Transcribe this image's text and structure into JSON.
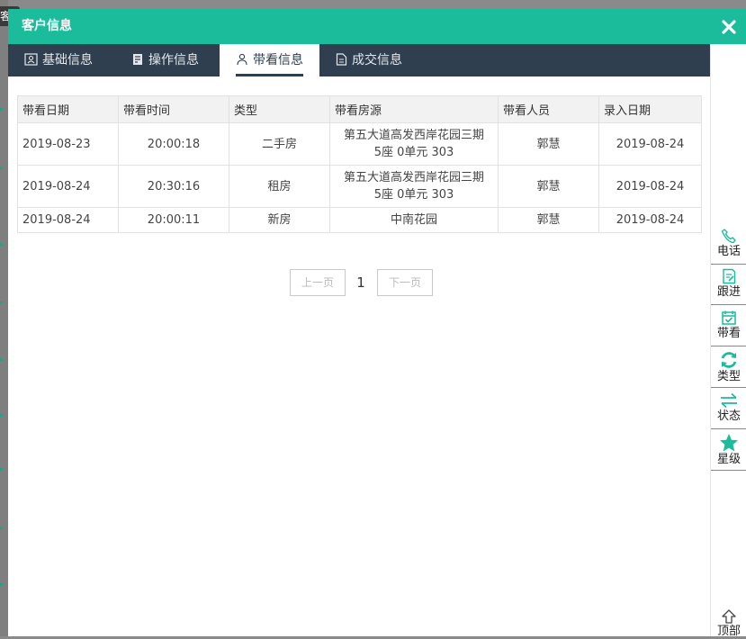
{
  "bg": {
    "tag": "客"
  },
  "modal": {
    "title": "客户信息"
  },
  "tabs": [
    {
      "label": "基础信息",
      "icon": "id-card-icon"
    },
    {
      "label": "操作信息",
      "icon": "edit-note-icon"
    },
    {
      "label": "带看信息",
      "icon": "people-icon",
      "active": true
    },
    {
      "label": "成交信息",
      "icon": "document-icon"
    }
  ],
  "table": {
    "headers": [
      "带看日期",
      "带看时间",
      "类型",
      "带看房源",
      "带看人员",
      "录入日期"
    ],
    "rows": [
      {
        "date": "2019-08-23",
        "time": "20:00:18",
        "type": "二手房",
        "house_line1": "第五大道高发西岸花园三期",
        "house_line2": "5座 0单元 303",
        "staff": "郭慧",
        "entry": "2019-08-24"
      },
      {
        "date": "2019-08-24",
        "time": "20:30:16",
        "type": "租房",
        "house_line1": "第五大道高发西岸花园三期",
        "house_line2": "5座 0单元 303",
        "staff": "郭慧",
        "entry": "2019-08-24"
      },
      {
        "date": "2019-08-24",
        "time": "20:00:11",
        "type": "新房",
        "house_line1": "中南花园",
        "house_line2": "",
        "staff": "郭慧",
        "entry": "2019-08-24"
      }
    ]
  },
  "pager": {
    "prev": "上一页",
    "page": "1",
    "next": "下一页"
  },
  "sidebar": {
    "items": [
      {
        "label": "电话",
        "icon": "phone-icon"
      },
      {
        "label": "跟进",
        "icon": "follow-up-icon"
      },
      {
        "label": "带看",
        "icon": "calendar-check-icon"
      },
      {
        "label": "类型",
        "icon": "refresh-icon"
      },
      {
        "label": "状态",
        "icon": "swap-icon"
      },
      {
        "label": "星级",
        "icon": "star-icon"
      }
    ],
    "top": "顶部"
  },
  "colors": {
    "header": "#1abc9c",
    "tabbar": "#2f3f4f",
    "accent": "#1abc9c"
  }
}
